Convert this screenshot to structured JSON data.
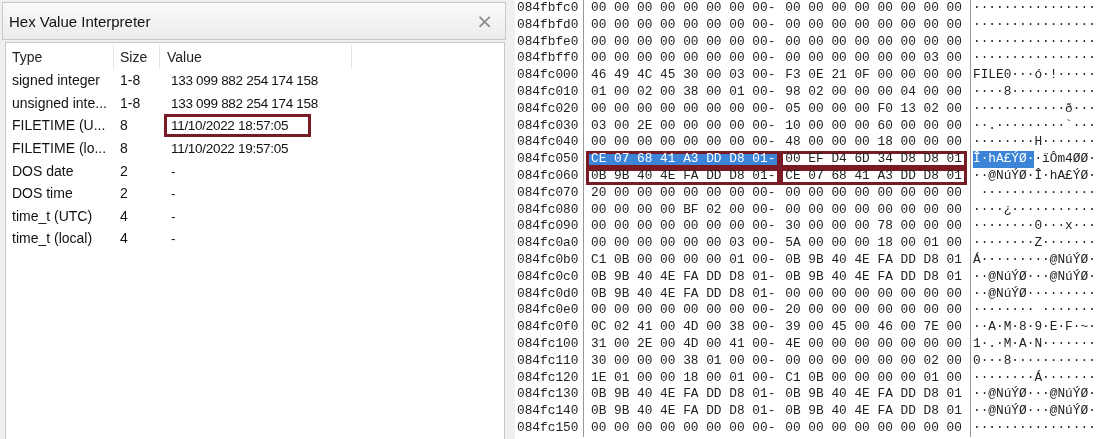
{
  "interpreter": {
    "title": "Hex Value Interpreter",
    "close": "×",
    "columns": [
      "Type",
      "Size",
      "Value"
    ],
    "rows": [
      {
        "type": "signed integer",
        "size": "1-8",
        "value": "133 099 882 254 174 158",
        "boxed": false
      },
      {
        "type": "unsigned inte...",
        "size": "1-8",
        "value": "133 099 882 254 174 158",
        "boxed": false
      },
      {
        "type": "FILETIME (U...",
        "size": "8",
        "value": "11/10/2022 18:57:05",
        "boxed": true
      },
      {
        "type": "FILETIME (lo...",
        "size": "8",
        "value": "11/10/2022 19:57:05",
        "boxed": false
      },
      {
        "type": "DOS date",
        "size": "2",
        "value": "-",
        "boxed": false
      },
      {
        "type": "DOS time",
        "size": "2",
        "value": "-",
        "boxed": false
      },
      {
        "type": "time_t (UTC)",
        "size": "4",
        "value": "-",
        "boxed": false
      },
      {
        "type": "time_t (local)",
        "size": "4",
        "value": "-",
        "boxed": false
      }
    ]
  },
  "hex_view": {
    "rows": [
      {
        "address": "084fbfc0",
        "hex_left": "00 00 00 00 00 00 00 00-",
        "hex_right": "00 00 00 00 00 00 00 00",
        "ascii_left": "········",
        "ascii_right": "········",
        "selected": false,
        "boxed_left": false,
        "boxed_right": false
      },
      {
        "address": "084fbfd0",
        "hex_left": "00 00 00 00 00 00 00 00-",
        "hex_right": "00 00 00 00 00 00 00 00",
        "ascii_left": "········",
        "ascii_right": "········",
        "selected": false,
        "boxed_left": false,
        "boxed_right": false
      },
      {
        "address": "084fbfe0",
        "hex_left": "00 00 00 00 00 00 00 00-",
        "hex_right": "00 00 00 00 00 00 00 00",
        "ascii_left": "········",
        "ascii_right": "········",
        "selected": false,
        "boxed_left": false,
        "boxed_right": false
      },
      {
        "address": "084fbff0",
        "hex_left": "00 00 00 00 00 00 00 00-",
        "hex_right": "00 00 00 00 00 00 03 00",
        "ascii_left": "········",
        "ascii_right": "········",
        "selected": false,
        "boxed_left": false,
        "boxed_right": false
      },
      {
        "address": "084fc000",
        "hex_left": "46 49 4C 45 30 00 03 00-",
        "hex_right": "F3 0E 21 0F 00 00 00 00",
        "ascii_left": "FILE0···",
        "ascii_right": "ó·!·····",
        "selected": false,
        "boxed_left": false,
        "boxed_right": false
      },
      {
        "address": "084fc010",
        "hex_left": "01 00 02 00 38 00 01 00-",
        "hex_right": "98 02 00 00 00 04 00 00",
        "ascii_left": "····8···",
        "ascii_right": "········",
        "selected": false,
        "boxed_left": false,
        "boxed_right": false
      },
      {
        "address": "084fc020",
        "hex_left": "00 00 00 00 00 00 00 00-",
        "hex_right": "05 00 00 00 F0 13 02 00",
        "ascii_left": "········",
        "ascii_right": "····ð···",
        "selected": false,
        "boxed_left": false,
        "boxed_right": false
      },
      {
        "address": "084fc030",
        "hex_left": "03 00 2E 00 00 00 00 00-",
        "hex_right": "10 00 00 00 60 00 00 00",
        "ascii_left": "··.·····",
        "ascii_right": "····`···",
        "selected": false,
        "boxed_left": false,
        "boxed_right": false
      },
      {
        "address": "084fc040",
        "hex_left": "00 00 00 00 00 00 00 00-",
        "hex_right": "48 00 00 00 18 00 00 00",
        "ascii_left": "········",
        "ascii_right": "H·······",
        "selected": false,
        "boxed_left": false,
        "boxed_right": false
      },
      {
        "address": "084fc050",
        "hex_left": "CE 07 68 41 A3 DD D8 01-",
        "hex_right": "00 EF D4 6D 34 D8 D8 01",
        "ascii_left": "Î·hA£ÝØ·",
        "ascii_right": "·ïÔm4ØØ·",
        "selected": true,
        "boxed_left": true,
        "boxed_right": true
      },
      {
        "address": "084fc060",
        "hex_left": "0B 9B 40 4E FA DD D8 01-",
        "hex_right": "CE 07 68 41 A3 DD D8 01",
        "ascii_left": "··@NúÝØ·",
        "ascii_right": "Î·hA£ÝØ·",
        "selected": false,
        "boxed_left": true,
        "boxed_right": true
      },
      {
        "address": "084fc070",
        "hex_left": "20 00 00 00 00 00 00 00-",
        "hex_right": "00 00 00 00 00 00 00 00",
        "ascii_left": " ·······",
        "ascii_right": "········",
        "selected": false,
        "boxed_left": false,
        "boxed_right": false
      },
      {
        "address": "084fc080",
        "hex_left": "00 00 00 00 BF 02 00 00-",
        "hex_right": "00 00 00 00 00 00 00 00",
        "ascii_left": "····¿···",
        "ascii_right": "········",
        "selected": false,
        "boxed_left": false,
        "boxed_right": false
      },
      {
        "address": "084fc090",
        "hex_left": "00 00 00 00 00 00 00 00-",
        "hex_right": "30 00 00 00 78 00 00 00",
        "ascii_left": "········",
        "ascii_right": "0···x···",
        "selected": false,
        "boxed_left": false,
        "boxed_right": false
      },
      {
        "address": "084fc0a0",
        "hex_left": "00 00 00 00 00 00 03 00-",
        "hex_right": "5A 00 00 00 18 00 01 00",
        "ascii_left": "········",
        "ascii_right": "Z·······",
        "selected": false,
        "boxed_left": false,
        "boxed_right": false
      },
      {
        "address": "084fc0b0",
        "hex_left": "C1 0B 00 00 00 00 01 00-",
        "hex_right": "0B 9B 40 4E FA DD D8 01",
        "ascii_left": "Á·······",
        "ascii_right": "··@NúÝØ·",
        "selected": false,
        "boxed_left": false,
        "boxed_right": false
      },
      {
        "address": "084fc0c0",
        "hex_left": "0B 9B 40 4E FA DD D8 01-",
        "hex_right": "0B 9B 40 4E FA DD D8 01",
        "ascii_left": "··@NúÝØ·",
        "ascii_right": "··@NúÝØ·",
        "selected": false,
        "boxed_left": false,
        "boxed_right": false
      },
      {
        "address": "084fc0d0",
        "hex_left": "0B 9B 40 4E FA DD D8 01-",
        "hex_right": "00 00 00 00 00 00 00 00",
        "ascii_left": "··@NúÝØ·",
        "ascii_right": "········",
        "selected": false,
        "boxed_left": false,
        "boxed_right": false
      },
      {
        "address": "084fc0e0",
        "hex_left": "00 00 00 00 00 00 00 00-",
        "hex_right": "20 00 00 00 00 00 00 00",
        "ascii_left": "········",
        "ascii_right": " ·······",
        "selected": false,
        "boxed_left": false,
        "boxed_right": false
      },
      {
        "address": "084fc0f0",
        "hex_left": "0C 02 41 00 4D 00 38 00-",
        "hex_right": "39 00 45 00 46 00 7E 00",
        "ascii_left": "··A·M·8·",
        "ascii_right": "9·E·F·~·",
        "selected": false,
        "boxed_left": false,
        "boxed_right": false
      },
      {
        "address": "084fc100",
        "hex_left": "31 00 2E 00 4D 00 41 00-",
        "hex_right": "4E 00 00 00 00 00 00 00",
        "ascii_left": "1·.·M·A·",
        "ascii_right": "N·······",
        "selected": false,
        "boxed_left": false,
        "boxed_right": false
      },
      {
        "address": "084fc110",
        "hex_left": "30 00 00 00 38 01 00 00-",
        "hex_right": "00 00 00 00 00 00 02 00",
        "ascii_left": "0···8···",
        "ascii_right": "········",
        "selected": false,
        "boxed_left": false,
        "boxed_right": false
      },
      {
        "address": "084fc120",
        "hex_left": "1E 01 00 00 18 00 01 00-",
        "hex_right": "C1 0B 00 00 00 00 01 00",
        "ascii_left": "········",
        "ascii_right": "Á·······",
        "selected": false,
        "boxed_left": false,
        "boxed_right": false
      },
      {
        "address": "084fc130",
        "hex_left": "0B 9B 40 4E FA DD D8 01-",
        "hex_right": "0B 9B 40 4E FA DD D8 01",
        "ascii_left": "··@NúÝØ·",
        "ascii_right": "··@NúÝØ·",
        "selected": false,
        "boxed_left": false,
        "boxed_right": false
      },
      {
        "address": "084fc140",
        "hex_left": "0B 9B 40 4E FA DD D8 01-",
        "hex_right": "0B 9B 40 4E FA DD D8 01",
        "ascii_left": "··@NúÝØ·",
        "ascii_right": "··@NúÝØ·",
        "selected": false,
        "boxed_left": false,
        "boxed_right": false
      },
      {
        "address": "084fc150",
        "hex_left": "00 00 00 00 00 00 00 00-",
        "hex_right": "00 00 00 00 00 00 00 00",
        "ascii_left": "········",
        "ascii_right": "········",
        "selected": false,
        "boxed_left": false,
        "boxed_right": false
      }
    ]
  }
}
